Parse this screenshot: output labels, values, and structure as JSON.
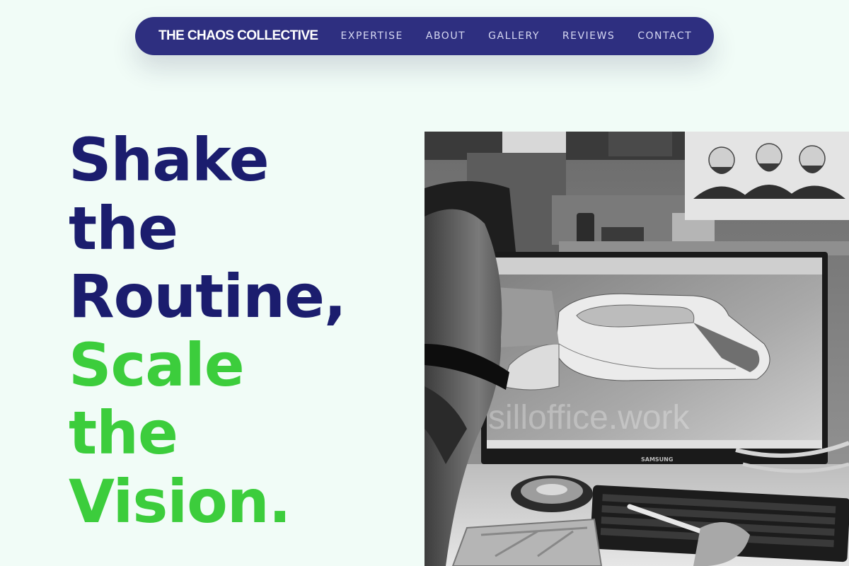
{
  "nav": {
    "brand": "THE CHAOS COLLECTIVE",
    "links": [
      "EXPERTISE",
      "ABOUT",
      "GALLERY",
      "REVIEWS",
      "CONTACT"
    ]
  },
  "hero": {
    "lines_primary": [
      "Shake",
      "the",
      "Routine,"
    ],
    "lines_accent": [
      "Scale",
      "the",
      "Vision."
    ]
  },
  "photo": {
    "monitor_brand": "SAMSUNG",
    "watermark": "silloffice.work"
  },
  "colors": {
    "background": "#f1fcf7",
    "nav_bg": "#2e2f80",
    "headline_primary": "#1b1d6e",
    "headline_accent": "#3ccd3c"
  }
}
